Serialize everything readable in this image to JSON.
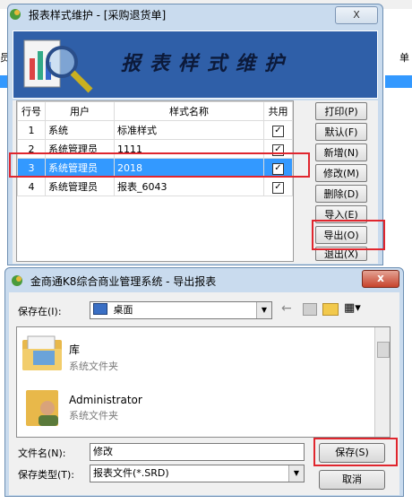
{
  "background": {
    "left_label": "员",
    "right_label": "单"
  },
  "report_window": {
    "title": "报表样式维护 - [采购退货单]",
    "close_label": "X",
    "banner_title": "报表样式维护",
    "columns": [
      "行号",
      "用户",
      "样式名称",
      "共用"
    ],
    "rows": [
      {
        "no": "1",
        "user": "系统",
        "style": "标准样式",
        "shared": true
      },
      {
        "no": "2",
        "user": "系统管理员",
        "style": "1111",
        "shared": true
      },
      {
        "no": "3",
        "user": "系统管理员",
        "style": "2018",
        "shared": true
      },
      {
        "no": "4",
        "user": "系统管理员",
        "style": "报表_6043",
        "shared": true
      }
    ],
    "selected_row": 2,
    "buttons": [
      "打印(P)",
      "默认(F)",
      "新增(N)",
      "修改(M)",
      "删除(D)",
      "导入(E)",
      "导出(O)",
      "退出(X)"
    ]
  },
  "export_dialog": {
    "title": "金商通K8综合商业管理系统 - 导出报表",
    "close_label": "x",
    "save_in_label": "保存在(I):",
    "save_in_value": "桌面",
    "files": [
      {
        "name": "库",
        "type": "系统文件夹"
      },
      {
        "name": "Administrator",
        "type": "系统文件夹"
      }
    ],
    "filename_label": "文件名(N):",
    "filename_value": "修改",
    "filetype_label": "保存类型(T):",
    "filetype_value": "报表文件(*.SRD)",
    "save_button": "保存(S)",
    "cancel_button": "取消"
  },
  "colors": {
    "highlight": "#3399ff",
    "annotation_red": "#e0262e",
    "banner_blue": "#2f5fa8"
  }
}
